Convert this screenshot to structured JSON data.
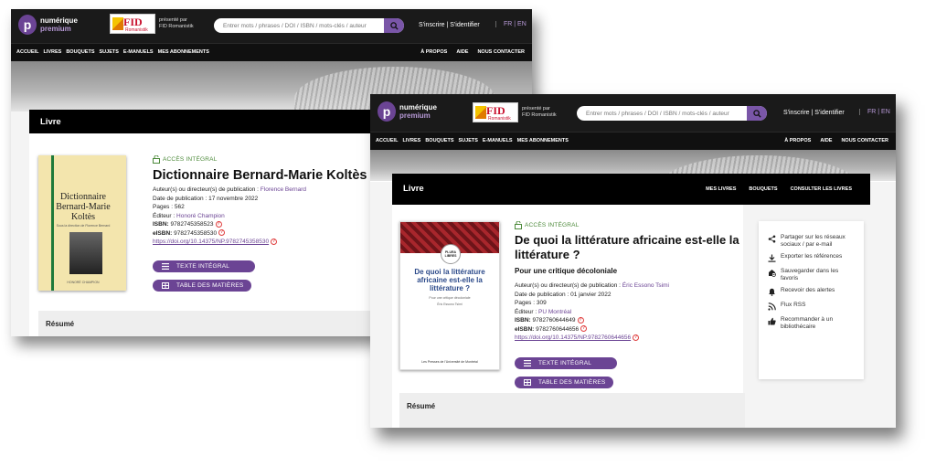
{
  "header": {
    "logo_line1": "numérique",
    "logo_line2": "premium",
    "fid_text": "FID",
    "fid_sub": "Romanistik",
    "presented_by": "présenté par",
    "presenter": "FID Romanistik",
    "search_placeholder": "Entrer mots / phrases / DOI / ISBN / mots-clés / auteur",
    "auth": "S'inscrire | S'identifier",
    "lang": "FR | EN"
  },
  "nav": {
    "left": [
      "ACCUEIL",
      "LIVRES",
      "BOUQUETS",
      "SUJETS",
      "E-MANUELS",
      "MES ABONNEMENTS"
    ],
    "right": [
      "À PROPOS",
      "AIDE",
      "NOUS CONTACTER"
    ]
  },
  "band": {
    "title": "Livre",
    "links": [
      "MES LIVRES",
      "BOUQUETS",
      "CONSULTER LES LIVRES"
    ]
  },
  "book_a": {
    "access": "ACCÈS INTÉGRAL",
    "title": "Dictionnaire Bernard-Marie Koltès",
    "author_label": "Auteur(s) ou directeur(s) de publication : ",
    "author": "Florence Bernard",
    "date_label": "Date de publication : ",
    "date": "17 novembre 2022",
    "pages_label": "Pages : ",
    "pages": "562",
    "editor_label": "Éditeur : ",
    "editor": "Honoré Champion",
    "isbn_label": "ISBN: ",
    "isbn": "9782745358523",
    "eisbn_label": "eISBN: ",
    "eisbn": "9782745358530",
    "doi": "https://doi.org/10.14375/NP.9782745358530",
    "cover_title": "Dictionnaire Bernard-Marie Koltès",
    "cover_sub": "Sous la direction de Florence Bernard",
    "cover_pub": "HONORÉ CHAMPION"
  },
  "book_b": {
    "access": "ACCÈS INTÉGRAL",
    "title": "De quoi la littérature africaine est-elle la littérature ?",
    "subtitle": "Pour une critique décoloniale",
    "author_label": "Auteur(s) ou directeur(s) de publication : ",
    "author": "Éric Essono Tsimi",
    "date_label": "Date de publication : ",
    "date": "01 janvier 2022",
    "pages_label": "Pages : ",
    "pages": "309",
    "editor_label": "Éditeur : ",
    "editor": "PU Montréal",
    "isbn_label": "ISBN: ",
    "isbn": "9782760644649",
    "eisbn_label": "eISBN: ",
    "eisbn": "9782760644656",
    "doi": "https://doi.org/10.14375/NP.9782760644656",
    "cover_badge": "PLURA LIBRES",
    "cover_title": "De quoi la littérature africaine est-elle la littérature ?",
    "cover_sub": "Pour une critique décoloniale",
    "cover_author": "Éric Essono Tsimi",
    "cover_pub": "Les Presses de l'Université de Montréal"
  },
  "buttons": {
    "full_text": "TEXTE INTÉGRAL",
    "toc": "TABLE DES MATIÈRES"
  },
  "resume": {
    "title": "Résumé"
  },
  "share": [
    {
      "icon": "share-icon",
      "label": "Partager sur les réseaux sociaux / par e-mail"
    },
    {
      "icon": "download-icon",
      "label": "Exporter les références"
    },
    {
      "icon": "bookmark-icon",
      "label": "Sauvegarder dans les favoris"
    },
    {
      "icon": "bell-icon",
      "label": "Recevoir des alertes"
    },
    {
      "icon": "rss-icon",
      "label": "Flux RSS"
    },
    {
      "icon": "thumbs-up-icon",
      "label": "Recommander à un bibliothécaire"
    }
  ],
  "colors": {
    "accent": "#6b4494",
    "access_green": "#4c8a3a",
    "header_bg": "#1a1a1a"
  }
}
